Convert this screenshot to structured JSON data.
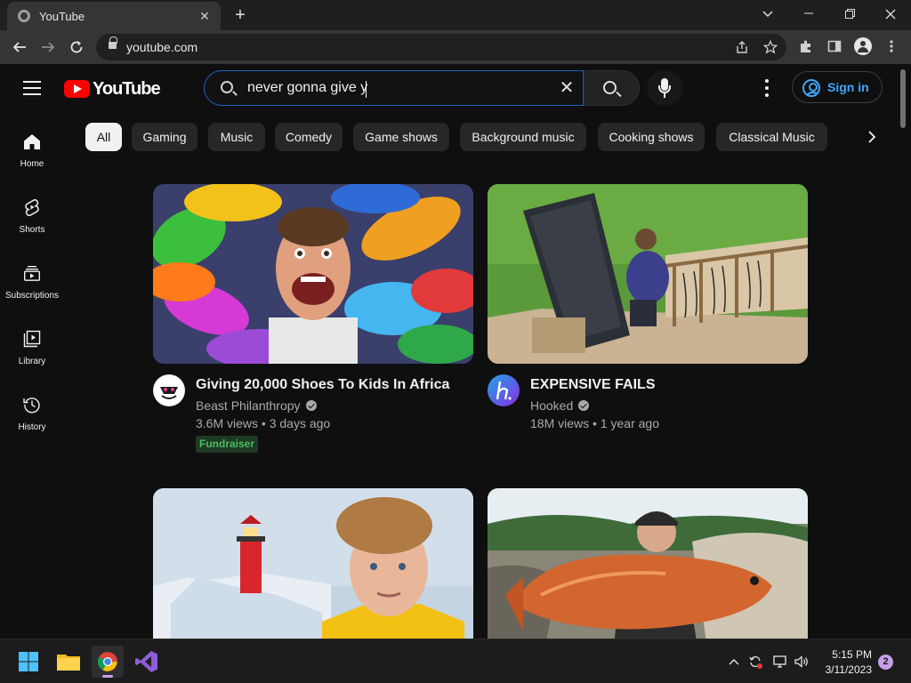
{
  "browser": {
    "tab_title": "YouTube",
    "url": "youtube.com",
    "new_tab_symbol": "+",
    "tab_close_symbol": "✕"
  },
  "youtube": {
    "logo_text": "YouTube",
    "search": {
      "query": "never gonna give y",
      "clear_symbol": "✕"
    },
    "sign_in_label": "Sign in",
    "sidebar": [
      {
        "label": "Home",
        "icon": "home-icon"
      },
      {
        "label": "Shorts",
        "icon": "shorts-icon"
      },
      {
        "label": "Subscriptions",
        "icon": "subscriptions-icon"
      },
      {
        "label": "Library",
        "icon": "library-icon"
      },
      {
        "label": "History",
        "icon": "history-icon"
      }
    ],
    "chips": [
      "All",
      "Gaming",
      "Music",
      "Comedy",
      "Game shows",
      "Background music",
      "Cooking shows",
      "Classical Music"
    ],
    "active_chip": "All",
    "videos": [
      {
        "title": "Giving 20,000 Shoes To Kids In Africa",
        "channel": "Beast Philanthropy",
        "verified": true,
        "views": "3.6M views",
        "age": "3 days ago",
        "badge": "Fundraiser"
      },
      {
        "title": "EXPENSIVE FAILS",
        "channel": "Hooked",
        "verified": true,
        "views": "18M views",
        "age": "1 year ago",
        "badge": ""
      }
    ],
    "meta_separator": "•",
    "colors": {
      "brand_red": "#ff0000",
      "link_blue": "#3ea6ff",
      "search_focus": "#1c62b9",
      "fundraiser_green": "#4cbb63",
      "background": "#0f0f0f"
    }
  },
  "taskbar": {
    "apps": [
      "windows-start-icon",
      "file-explorer-icon",
      "chrome-icon",
      "visual-studio-icon"
    ],
    "time": "5:15 PM",
    "date": "3/11/2023",
    "notification_count": "2"
  }
}
